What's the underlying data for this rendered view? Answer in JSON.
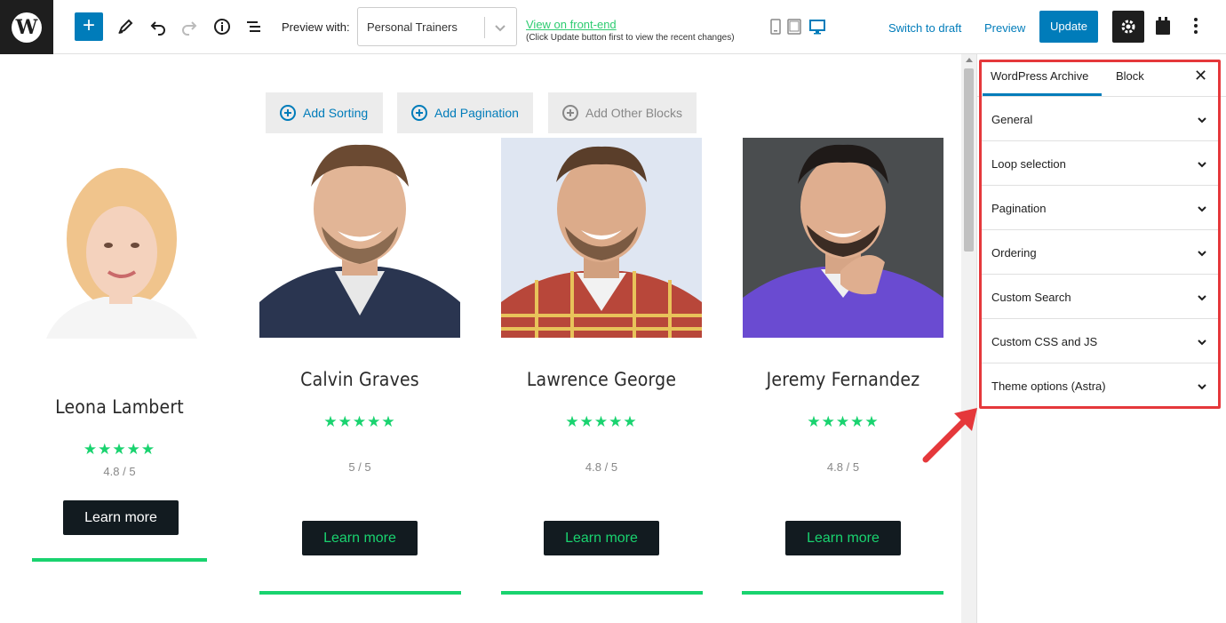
{
  "topbar": {
    "logo_text": "W",
    "preview_label": "Preview with:",
    "preview_select_value": "Personal Trainers",
    "view_link": "View on front-end",
    "view_note": "(Click Update button first to view the recent changes)",
    "switch_draft": "Switch to draft",
    "preview": "Preview",
    "update": "Update",
    "icons": [
      "plus-icon",
      "pencil-icon",
      "undo-icon",
      "redo-icon",
      "info-icon",
      "list-view-icon",
      "mobile-icon",
      "tablet-icon",
      "desktop-icon",
      "gear-icon",
      "plugin-icon",
      "more-vertical-icon"
    ]
  },
  "canvas": {
    "toolbar": {
      "add_sorting": "Add Sorting",
      "add_pagination": "Add Pagination",
      "add_other_blocks": "Add Other Blocks"
    },
    "trainers": [
      {
        "name": "Leona Lambert",
        "stars": "★★★★★",
        "rating": "4.8 / 5",
        "button": "Learn more"
      },
      {
        "name": "Calvin Graves",
        "stars": "★★★★★",
        "rating": "5 / 5",
        "button": "Learn more"
      },
      {
        "name": "Lawrence George",
        "stars": "★★★★★",
        "rating": "4.8 / 5",
        "button": "Learn more"
      },
      {
        "name": "Jeremy Fernandez",
        "stars": "★★★★★",
        "rating": "4.8 / 5",
        "button": "Learn more"
      }
    ]
  },
  "sidebar": {
    "tabs": [
      "WordPress Archive",
      "Block"
    ],
    "close": "✕",
    "panels": [
      "General",
      "Loop selection",
      "Pagination",
      "Ordering",
      "Custom Search",
      "Custom CSS and JS",
      "Theme options (Astra)"
    ]
  },
  "colors": {
    "accent": "#007cba",
    "green": "#19d36f",
    "dark_button": "#121b20",
    "annotation_red": "#e5383b"
  }
}
